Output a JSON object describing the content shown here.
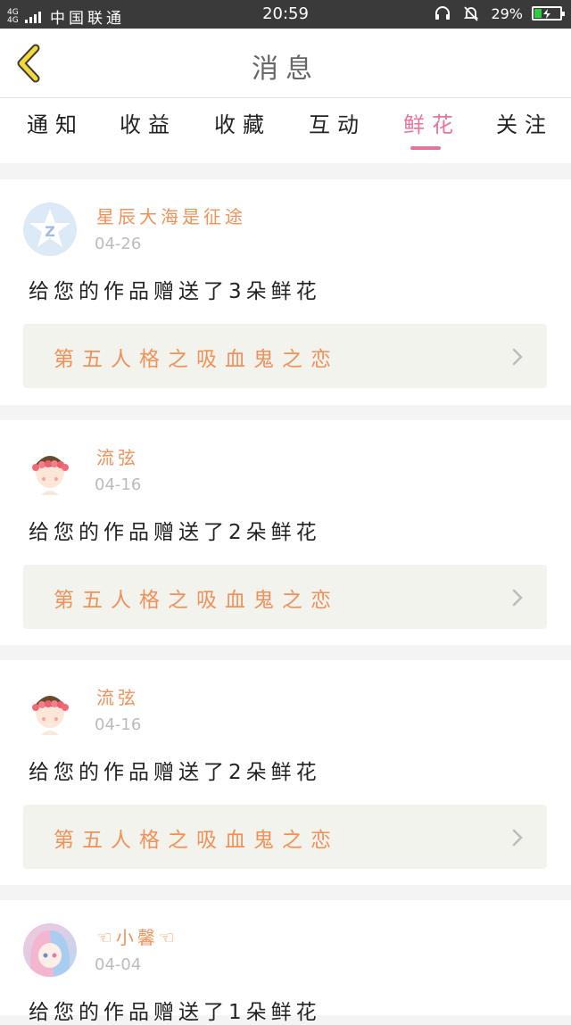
{
  "status_bar": {
    "network": "4G 4G",
    "carrier": "中国联通",
    "time": "20:59",
    "battery": "29%",
    "battery_level": 0.29,
    "icons": [
      "headset-icon",
      "mute-bell-icon",
      "battery-icon"
    ]
  },
  "header": {
    "title": "消息",
    "back_icon": "chevron-left-icon"
  },
  "tabs": [
    {
      "label": "通知"
    },
    {
      "label": "收益"
    },
    {
      "label": "收藏"
    },
    {
      "label": "互动"
    },
    {
      "label": "鲜花",
      "active": true
    },
    {
      "label": "关注"
    }
  ],
  "messages": [
    {
      "user": "星辰大海是征途",
      "date": "04-26",
      "text": "给您的作品赠送了3朵鲜花",
      "work": "第五人格之吸血鬼之恋",
      "avatar": "default-star-avatar"
    },
    {
      "user": "流弦",
      "date": "04-16",
      "text": "给您的作品赠送了2朵鲜花",
      "work": "第五人格之吸血鬼之恋",
      "avatar": "girl-flower-crown-avatar"
    },
    {
      "user": "流弦",
      "date": "04-16",
      "text": "给您的作品赠送了2朵鲜花",
      "work": "第五人格之吸血鬼之恋",
      "avatar": "girl-flower-crown-avatar"
    },
    {
      "user": "☜小馨☜",
      "date": "04-04",
      "text": "给您的作品赠送了1朵鲜花",
      "avatar": "anime-girl-avatar"
    }
  ],
  "colors": {
    "accent_pink": "#e8739a",
    "name_orange": "#f0915a",
    "back_yellow": "#f5d83a"
  }
}
